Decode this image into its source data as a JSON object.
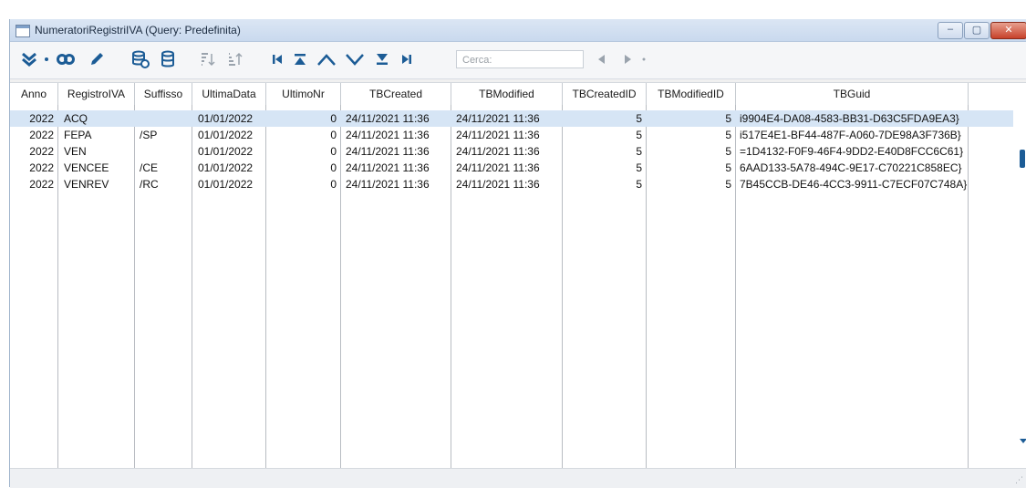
{
  "window": {
    "title": "NumeratoriRegistriIVA (Query: Predefinita)",
    "min_glyph": "‒",
    "max_glyph": "▢",
    "close_glyph": "✕"
  },
  "toolbar": {
    "search_placeholder": "Cerca:",
    "icons": [
      "expand-double-chevron-icon",
      "link-icon",
      "pencil-icon",
      "database-multi-icon",
      "database-icon",
      "sort-ascending-icon",
      "sort-descending-icon",
      "first-record-icon",
      "first-page-icon",
      "previous-icon",
      "next-icon",
      "last-page-icon",
      "last-record-icon",
      "search-prev-icon",
      "search-next-icon"
    ]
  },
  "grid": {
    "columns": [
      "Anno",
      "RegistroIVA",
      "Suffisso",
      "UltimaData",
      "UltimoNr",
      "TBCreated",
      "TBModified",
      "TBCreatedID",
      "TBModifiedID",
      "TBGuid"
    ],
    "rows": [
      {
        "anno": "2022",
        "registro": "ACQ",
        "suffisso": "",
        "data": "01/01/2022",
        "nr": "0",
        "created": "24/11/2021 11:36",
        "modified": "24/11/2021 11:36",
        "createdid": "5",
        "modifiedid": "5",
        "guid": "i9904E4-DA08-4583-BB31-D63C5FDA9EA3}"
      },
      {
        "anno": "2022",
        "registro": "FEPA",
        "suffisso": "/SP",
        "data": "01/01/2022",
        "nr": "0",
        "created": "24/11/2021 11:36",
        "modified": "24/11/2021 11:36",
        "createdid": "5",
        "modifiedid": "5",
        "guid": "i517E4E1-BF44-487F-A060-7DE98A3F736B}"
      },
      {
        "anno": "2022",
        "registro": "VEN",
        "suffisso": "",
        "data": "01/01/2022",
        "nr": "0",
        "created": "24/11/2021 11:36",
        "modified": "24/11/2021 11:36",
        "createdid": "5",
        "modifiedid": "5",
        "guid": "=1D4132-F0F9-46F4-9DD2-E40D8FCC6C61}"
      },
      {
        "anno": "2022",
        "registro": "VENCEE",
        "suffisso": "/CE",
        "data": "01/01/2022",
        "nr": "0",
        "created": "24/11/2021 11:36",
        "modified": "24/11/2021 11:36",
        "createdid": "5",
        "modifiedid": "5",
        "guid": "6AAD133-5A78-494C-9E17-C70221C858EC}"
      },
      {
        "anno": "2022",
        "registro": "VENREV",
        "suffisso": "/RC",
        "data": "01/01/2022",
        "nr": "0",
        "created": "24/11/2021 11:36",
        "modified": "24/11/2021 11:36",
        "createdid": "5",
        "modifiedid": "5",
        "guid": "7B45CCB-DE46-4CC3-9911-C7ECF07C748A}"
      }
    ]
  },
  "colors": {
    "accent": "#1c5c96",
    "selected_row": "#d6e5f5"
  }
}
